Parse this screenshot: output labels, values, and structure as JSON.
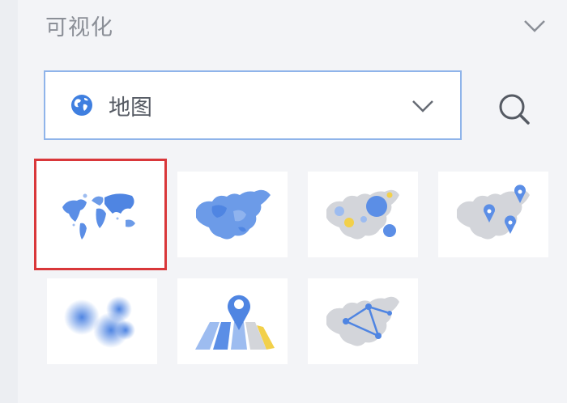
{
  "section": {
    "title": "可视化",
    "collapse_icon": "chevron-down-icon"
  },
  "chart_select": {
    "selected_label": "地图",
    "icon": "globe-icon",
    "dropdown_icon": "chevron-down-icon",
    "accent_color": "#8fb4ea"
  },
  "search": {
    "icon": "search-icon"
  },
  "chart_types": [
    {
      "name": "world-map",
      "selected": true
    },
    {
      "name": "china-map",
      "selected": false
    },
    {
      "name": "bubble-map",
      "selected": false
    },
    {
      "name": "marker-map",
      "selected": false
    },
    {
      "name": "heat-map",
      "selected": false
    },
    {
      "name": "location-map",
      "selected": false
    },
    {
      "name": "flow-map",
      "selected": false
    }
  ],
  "colors": {
    "primary_blue": "#5b8ee6",
    "light_blue": "#9dbcf0",
    "gray_map": "#d3d5da",
    "yellow": "#f2d04a",
    "selected_border": "#d9373a"
  }
}
